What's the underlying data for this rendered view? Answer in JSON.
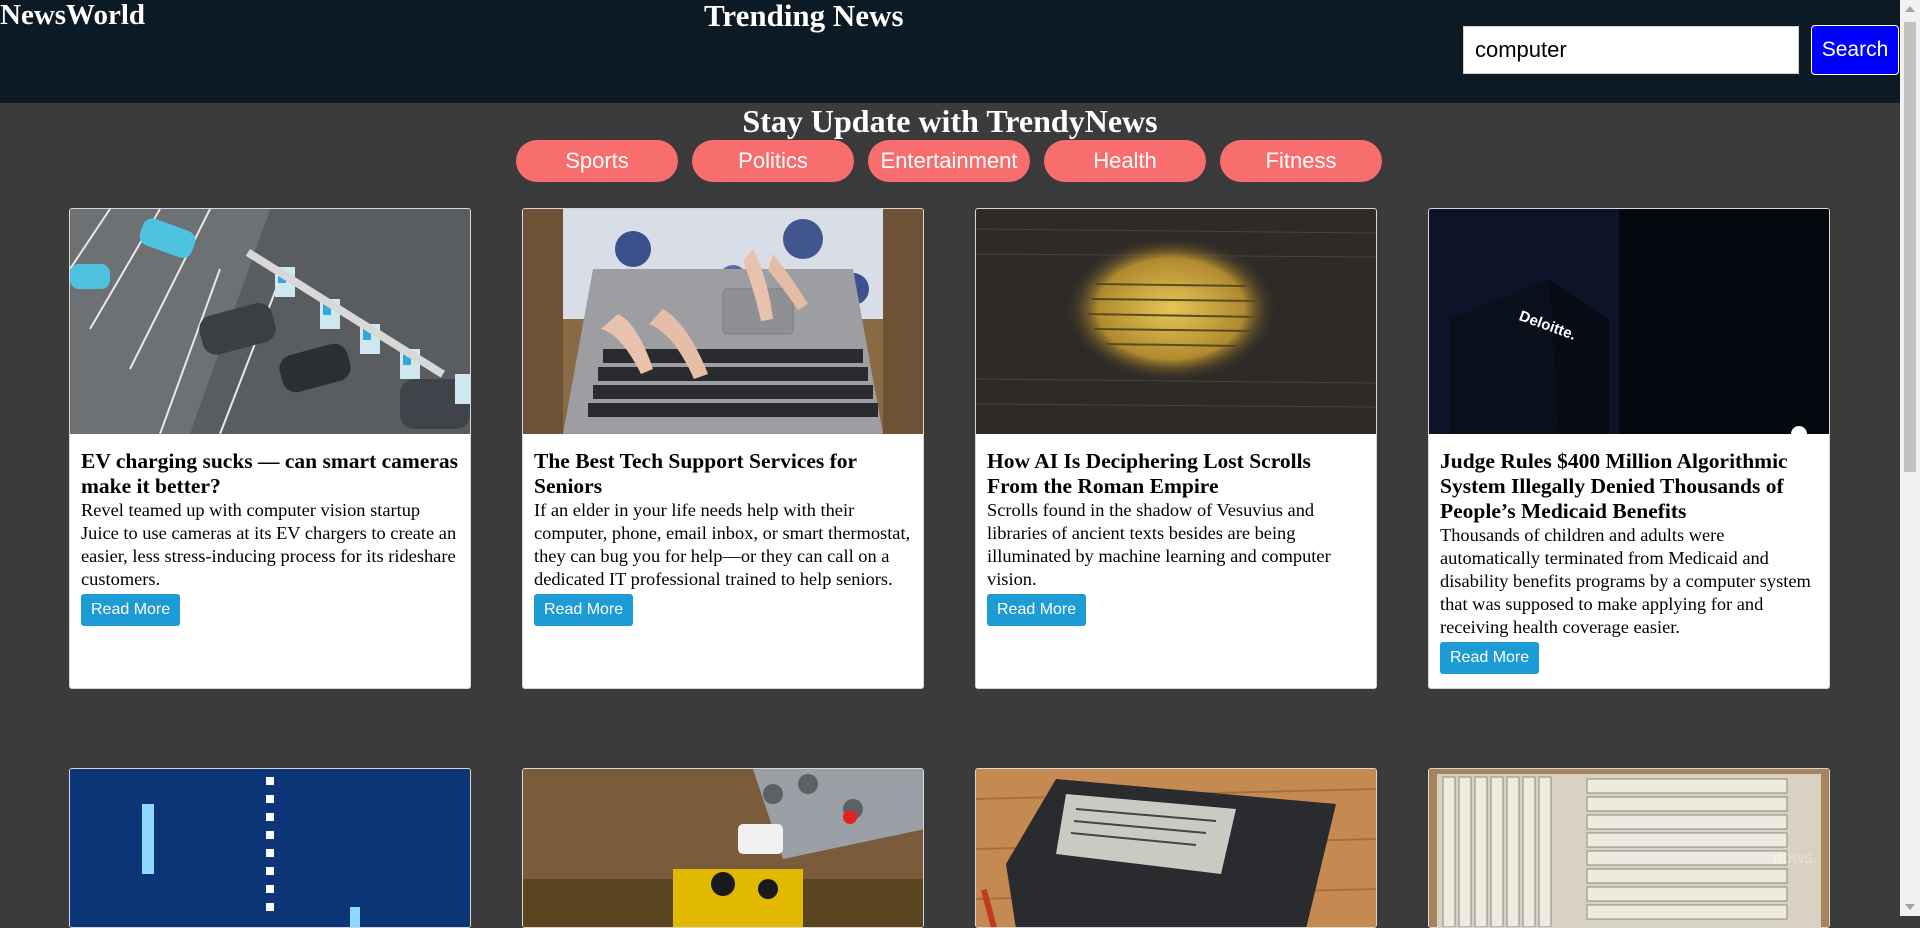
{
  "header": {
    "brand": "NewsWorld",
    "title": "Trending News",
    "search_value": "computer",
    "search_button": "Search"
  },
  "tagline": "Stay Update with TrendyNews",
  "categories": [
    "Sports",
    "Politics",
    "Entertainment",
    "Health",
    "Fitness"
  ],
  "articles": [
    {
      "title": "EV charging sucks — can smart cameras make it better?",
      "description": "Revel teamed up with computer vision startup Juice to use cameras at its EV chargers to create an easier, less stress-inducing process for its rideshare customers.",
      "button": "Read More"
    },
    {
      "title": "The Best Tech Support Services for Seniors",
      "description": "If an elder in your life needs help with their computer, phone, email inbox, or smart thermostat, they can bug you for help—or they can call on a dedicated IT professional trained to help seniors.",
      "button": "Read More"
    },
    {
      "title": "How AI Is Deciphering Lost Scrolls From the Roman Empire",
      "description": "Scrolls found in the shadow of Vesuvius and libraries of ancient texts besides are being illuminated by machine learning and computer vision.",
      "button": "Read More"
    },
    {
      "title": "Judge Rules $400 Million Algorithmic System Illegally Denied Thousands of People’s Medicaid Benefits",
      "description": "Thousands of children and adults were automatically terminated from Medicaid and disability benefits programs by a computer system that was supposed to make applying for and receiving health coverage easier.",
      "button": "Read More"
    }
  ],
  "watermark": "dows.",
  "colors": {
    "header_bg": "#0b1a24",
    "page_bg": "#3b3b3b",
    "category_bg": "#f86e6e",
    "search_button_bg": "#0000ff",
    "read_more_bg": "#1d9bd5"
  }
}
